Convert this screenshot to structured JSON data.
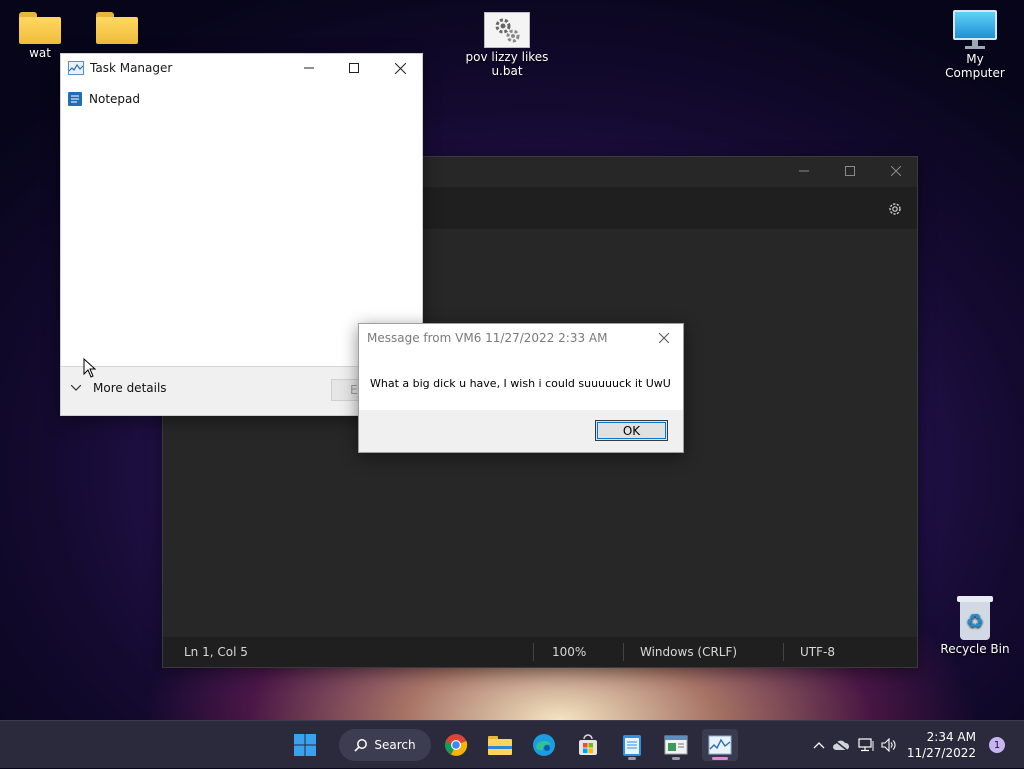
{
  "desktop": {
    "icons": [
      {
        "label": "wat"
      },
      {
        "label": ""
      },
      {
        "label": "pov lizzy likes u.bat"
      },
      {
        "label": "My Computer"
      },
      {
        "label": "Recycle Bin"
      }
    ]
  },
  "notepad": {
    "status": {
      "position": "Ln 1, Col 5",
      "zoom": "100%",
      "line_ending": "Windows (CRLF)",
      "encoding": "UTF-8"
    }
  },
  "task_manager": {
    "title": "Task Manager",
    "apps": [
      {
        "name": "Notepad"
      }
    ],
    "more_details": "More details",
    "end_task_partial": "E"
  },
  "message_box": {
    "title": "Message from VM6 11/27/2022 2:33 AM",
    "message": "What a big dick u have, I wish i could suuuuuck it UwU",
    "ok_label": "OK"
  },
  "taskbar": {
    "search_label": "Search",
    "time": "2:34 AM",
    "date": "11/27/2022",
    "notification_count": "1"
  },
  "colors": {
    "accent": "#0078d7",
    "notepad_dark": "#272727",
    "taskbar_bg": "#2a2a3c"
  }
}
